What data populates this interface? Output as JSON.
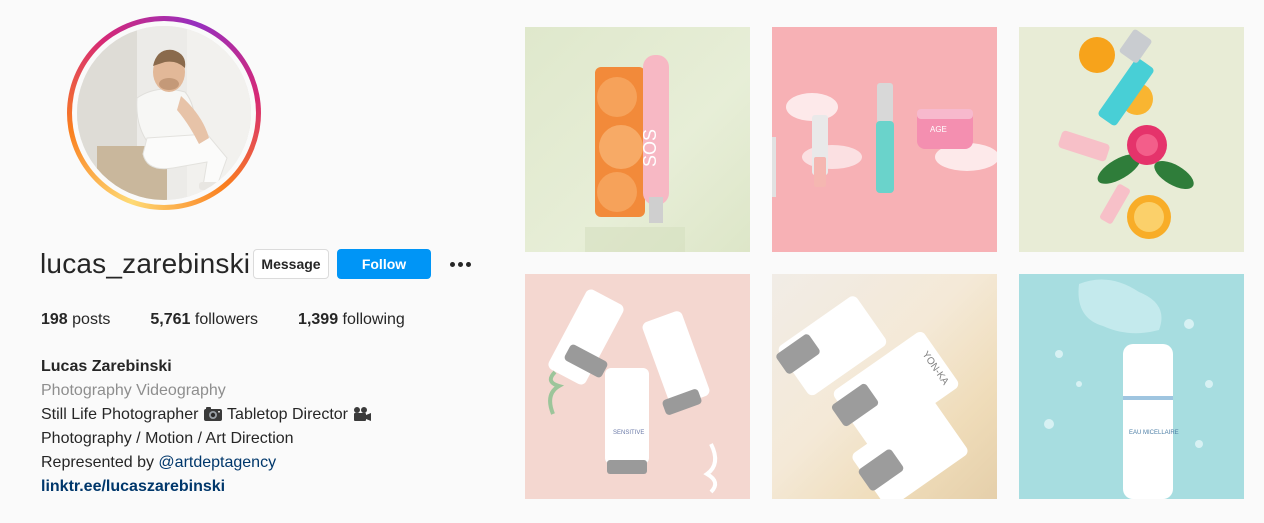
{
  "profile": {
    "username": "lucas_zarebinski",
    "message_label": "Message",
    "follow_label": "Follow",
    "stats": {
      "posts_count": "198",
      "posts_label": "posts",
      "followers_count": "5,761",
      "followers_label": "followers",
      "following_count": "1,399",
      "following_label": "following"
    },
    "bio": {
      "name": "Lucas Zarebinski",
      "category": "Photography Videography",
      "line1_a": "Still Life Photographer",
      "line1_b": "Tabletop Director",
      "line2": "Photography / Motion / Art Direction",
      "line3_prefix": "Represented by",
      "mention": "@artdeptagency",
      "link": "linktr.ee/lucaszarebinski"
    }
  },
  "icons": {
    "more": "more-options-icon",
    "camera": "camera-icon",
    "movie_camera": "movie-camera-icon"
  },
  "colors": {
    "follow_button": "#0095f6",
    "link_text": "#00376b",
    "muted_text": "#8e8e8e"
  },
  "posts": [
    {
      "id": "post-1",
      "product_text": "SOS"
    },
    {
      "id": "post-2",
      "product_text": "AGE"
    },
    {
      "id": "post-3",
      "product_text": ""
    },
    {
      "id": "post-4",
      "product_text": "SENSITIVE"
    },
    {
      "id": "post-5",
      "product_text": "YON-KA"
    },
    {
      "id": "post-6",
      "product_text": "EAU MICELLAIRE"
    }
  ]
}
